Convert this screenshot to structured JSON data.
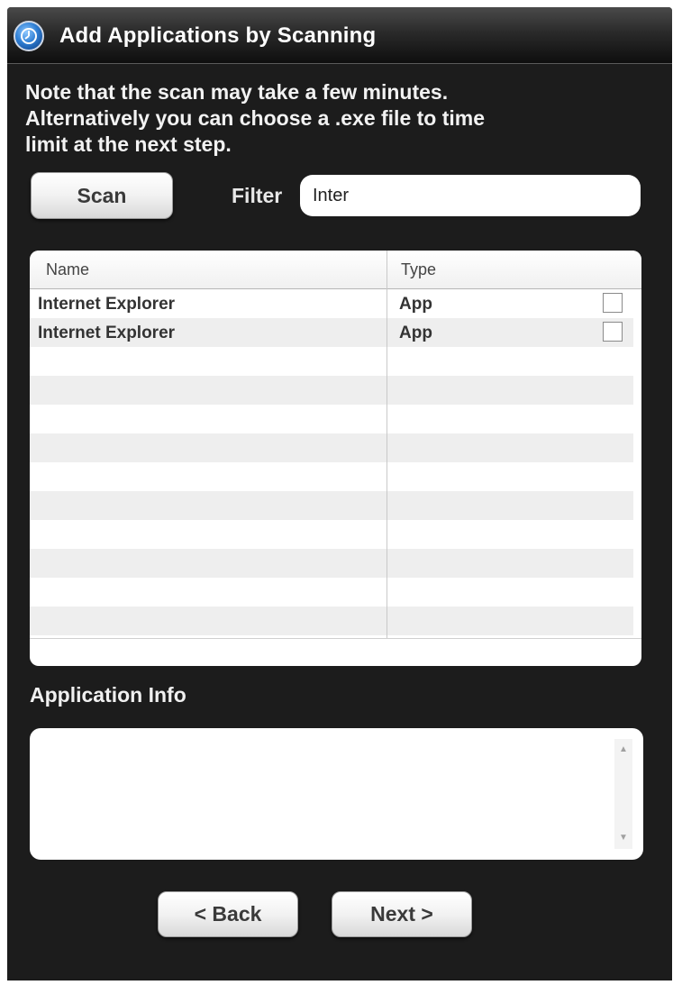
{
  "window": {
    "title": "Add Applications by Scanning",
    "icon": "clock-app-icon"
  },
  "note": {
    "line1": "Note that the scan may take a few minutes.",
    "line2": "Alternatively  you can choose a .exe file to time",
    "line3": "limit at the next step."
  },
  "toolbar": {
    "scan_label": "Scan",
    "filter_label": "Filter",
    "filter_value": "Inter"
  },
  "table": {
    "columns": [
      "Name",
      "Type"
    ],
    "rows": [
      {
        "name": "Internet Explorer",
        "type": "App",
        "checked": false
      },
      {
        "name": "Internet Explorer",
        "type": "App",
        "checked": false
      }
    ]
  },
  "info": {
    "label": "Application Info",
    "content": ""
  },
  "footer": {
    "back_label": "< Back",
    "next_label": "Next >"
  }
}
